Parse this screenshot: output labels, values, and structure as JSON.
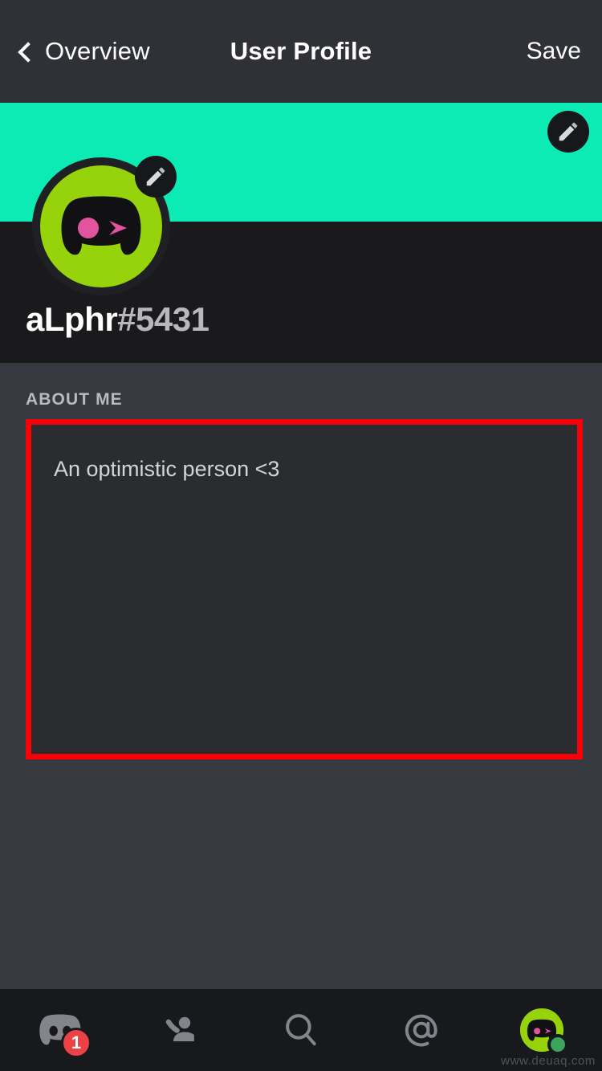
{
  "header": {
    "back_label": "Overview",
    "back_icon": "chevron-left-icon",
    "title": "User Profile",
    "save_label": "Save"
  },
  "banner": {
    "color": "#0debb4",
    "edit_icon": "pencil-icon"
  },
  "profile": {
    "avatar_bg_color": "#96d30a",
    "avatar_face_color": "#111113",
    "avatar_eye_color": "#e0559e",
    "avatar_edit_icon": "pencil-icon",
    "username": "aLphr",
    "discriminator": "#5431"
  },
  "about": {
    "section_label": "ABOUT ME",
    "bio_text": "An optimistic person <3",
    "highlight_color": "#fb0007",
    "field_bg_color": "#2a2c30"
  },
  "bottom_nav": {
    "items": [
      {
        "name": "servers",
        "icon": "discord-logo-icon",
        "badge": "1",
        "badge_color": "#ed4245",
        "active": false
      },
      {
        "name": "friends",
        "icon": "friends-icon",
        "badge": "",
        "active": false
      },
      {
        "name": "search",
        "icon": "search-icon",
        "badge": "",
        "active": false
      },
      {
        "name": "mentions",
        "icon": "at-mention-icon",
        "badge": "",
        "active": false
      },
      {
        "name": "profile",
        "icon": "user-avatar-icon",
        "badge": "",
        "status": "online",
        "status_color": "#3ba55d",
        "active": true
      }
    ]
  },
  "watermark": "www.deuaq.com"
}
